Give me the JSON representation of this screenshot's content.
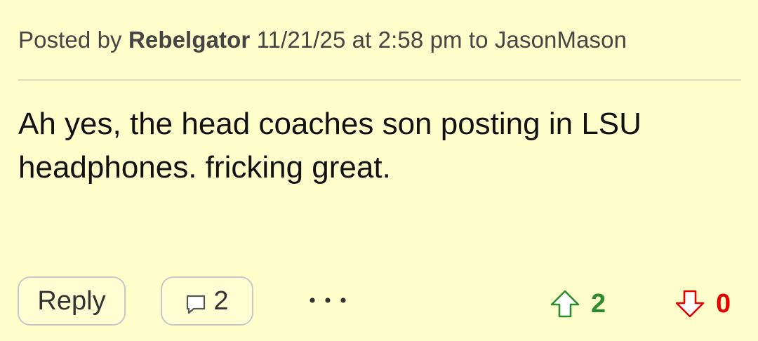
{
  "post": {
    "posted_by_prefix": "Posted by",
    "author": "Rebelgator",
    "timestamp": "11/21/25 at 2:58 pm",
    "to_prefix": "to",
    "reply_to_user": "JasonMason",
    "body": "Ah yes, the head coaches son posting in LSU headphones. fricking great."
  },
  "actions": {
    "reply_label": "Reply",
    "comment_count": "2",
    "upvotes": "2",
    "downvotes": "0",
    "icons": {
      "comment": "comment-bubble-icon",
      "more": "more-dots-icon",
      "upvote": "upvote-arrow-icon",
      "downvote": "downvote-arrow-icon"
    }
  },
  "colors": {
    "background": "#ffffcc",
    "upvote": "#2e8b2e",
    "downvote": "#e60000"
  }
}
